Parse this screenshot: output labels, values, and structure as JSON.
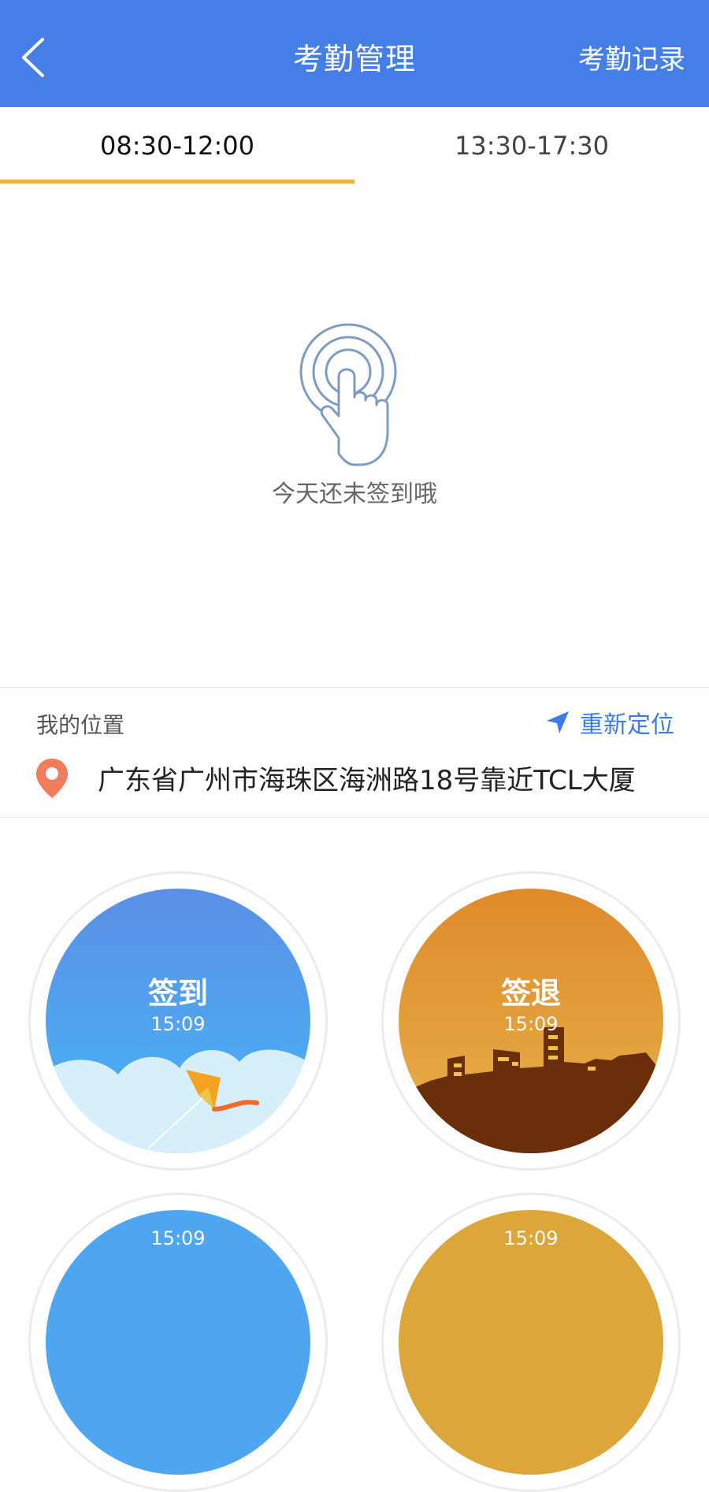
{
  "header": {
    "title": "考勤管理",
    "action_label": "考勤记录",
    "background_color": "#447ee6"
  },
  "tabs": [
    {
      "label": "08:30-12:00",
      "active": true
    },
    {
      "label": "13:30-17:30",
      "active": false
    }
  ],
  "tab_indicator_color": "#f0b13c",
  "empty_state": {
    "icon": "tap-finger-icon",
    "text": "今天还未签到哦"
  },
  "location": {
    "label": "我的位置",
    "relocate_label": "重新定位",
    "address": "广东省广州市海珠区海洲路18号靠近TCL大厦"
  },
  "punch_buttons": [
    {
      "label": "签到",
      "time": "15:09",
      "color": "#4aa7f5"
    },
    {
      "label": "签退",
      "time": "15:09",
      "color": "#e39a2d"
    }
  ],
  "partial_buttons": [
    {
      "time": "15:09"
    },
    {
      "time": "15:09"
    }
  ]
}
